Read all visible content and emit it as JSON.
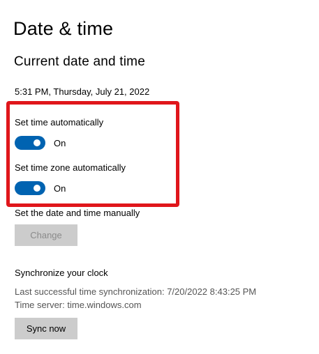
{
  "page": {
    "title": "Date & time"
  },
  "current": {
    "heading": "Current date and time",
    "datetime": "5:31 PM, Thursday, July 21, 2022"
  },
  "auto_settings": {
    "set_time_label": "Set time automatically",
    "set_time_state": "On",
    "set_time_on": true,
    "set_timezone_label": "Set time zone automatically",
    "set_timezone_state": "On",
    "set_timezone_on": true
  },
  "manual": {
    "label": "Set the date and time manually",
    "change_button": "Change"
  },
  "sync": {
    "heading": "Synchronize your clock",
    "last_sync": "Last successful time synchronization: 7/20/2022 8:43:25 PM",
    "time_server": "Time server: time.windows.com",
    "button": "Sync now"
  },
  "colors": {
    "toggle_on": "#0063b1",
    "highlight": "#e0161b",
    "button_bg": "#cccccc"
  }
}
